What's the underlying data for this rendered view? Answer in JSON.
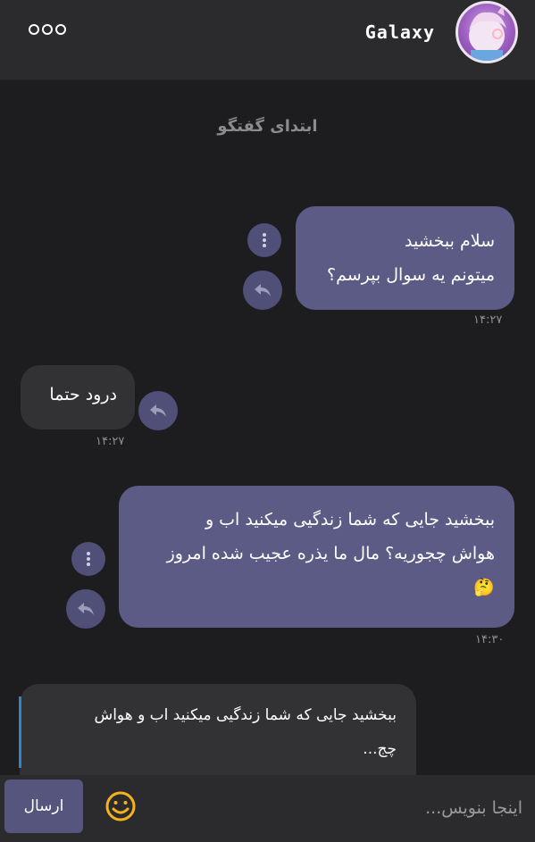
{
  "header": {
    "title": "Galaxy"
  },
  "conversation": {
    "start_label": "ابتدای گفتگو"
  },
  "messages": [
    {
      "direction": "outgoing",
      "lines": [
        "سلام ببخشید",
        "میتونم یه سوال بپرسم؟"
      ],
      "time": "۱۴:۲۷"
    },
    {
      "direction": "incoming",
      "lines": [
        "درود حتما"
      ],
      "time": "۱۴:۲۷"
    },
    {
      "direction": "outgoing",
      "lines": [
        "ببخشید جایی که شما زندگیی میکنید اب و",
        "هواش چجوریه؟ مال ما یذره عجیب شده امروز",
        "🤔"
      ],
      "time": "۱۴:۳۰"
    }
  ],
  "reply_preview": {
    "lines": [
      "ببخشید جایی که شما زندگیی میکنید اب و هواش",
      "چج..."
    ]
  },
  "composer": {
    "placeholder": "اینجا بنویس...",
    "send_label": "ارسال"
  },
  "icons": {
    "more": "more-dots-icon",
    "kebab": "kebab-icon",
    "reply": "reply-icon",
    "emoji": "emoji-icon"
  },
  "colors": {
    "background": "#1d1d1f",
    "header": "#2b2b2d",
    "outgoing_bubble": "#5b5b86",
    "incoming_bubble": "#323234",
    "accent": "#2f86c6",
    "emoji": "#f5b21a"
  }
}
